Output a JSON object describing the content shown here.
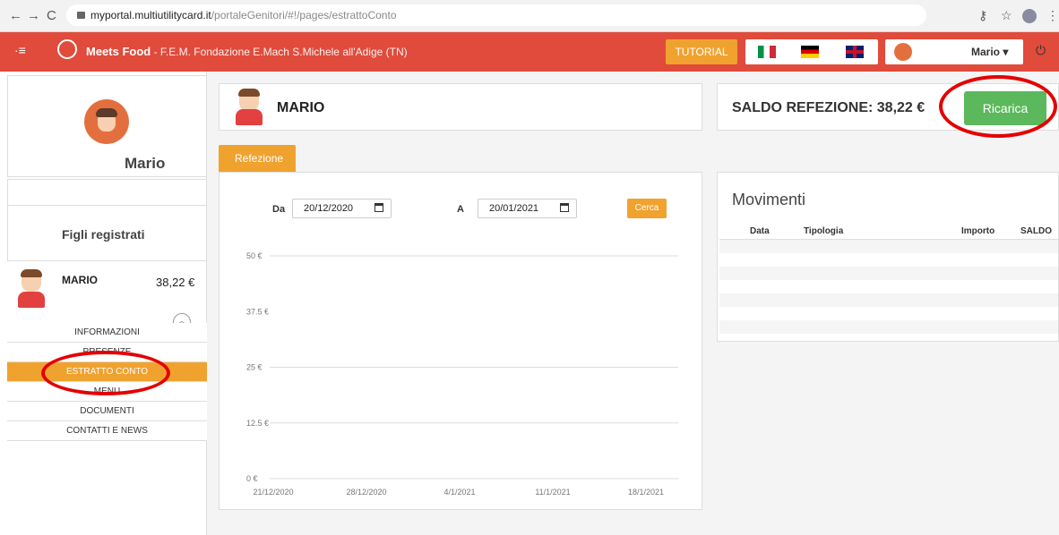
{
  "browser": {
    "url_host": "myportal.multiutilitycard.it",
    "url_path": "/portaleGenitori/#!/pages/estrattoConto"
  },
  "header": {
    "brand": "Meets Food",
    "brand_sub": " - F.E.M. Fondazione E.Mach S.Michele all'Adige (TN)",
    "tutorial": "TUTORIAL",
    "user_name": "Mario ▾"
  },
  "sidebar": {
    "profile_name": "Mario",
    "children_title": "Figli registrati",
    "child": {
      "name": "MARIO",
      "balance": "38,22 €"
    },
    "menu": [
      "INFORMAZIONI",
      "PRESENZE",
      "ESTRATTO CONTO",
      "MENU",
      "DOCUMENTI",
      "CONTATTI E NEWS"
    ],
    "active_index": 2
  },
  "main": {
    "student_name": "MARIO",
    "tab": "Refezione",
    "filter": {
      "from_label": "Da",
      "from_value": "20/12/2020",
      "to_label": "A",
      "to_value": "20/01/2021",
      "search": "Cerca"
    }
  },
  "chart_data": {
    "type": "line",
    "x_ticks": [
      "21/12/2020",
      "28/12/2020",
      "4/1/2021",
      "11/1/2021",
      "18/1/2021"
    ],
    "y_ticks": [
      "0 €",
      "12.5 €",
      "25 €",
      "37.5 €",
      "50 €"
    ],
    "ylim": [
      0,
      50
    ],
    "series": [],
    "grid": true
  },
  "balance": {
    "label": "SALDO REFEZIONE: 38,22 €",
    "recharge": "Ricarica"
  },
  "movements": {
    "title": "Movimenti",
    "columns": [
      "Data",
      "Tipologia",
      "Importo",
      "SALDO"
    ]
  },
  "colors": {
    "header": "#e04b3b",
    "accent": "#f0a22f",
    "recharge": "#5cb85c",
    "annotation": "#e30000"
  }
}
